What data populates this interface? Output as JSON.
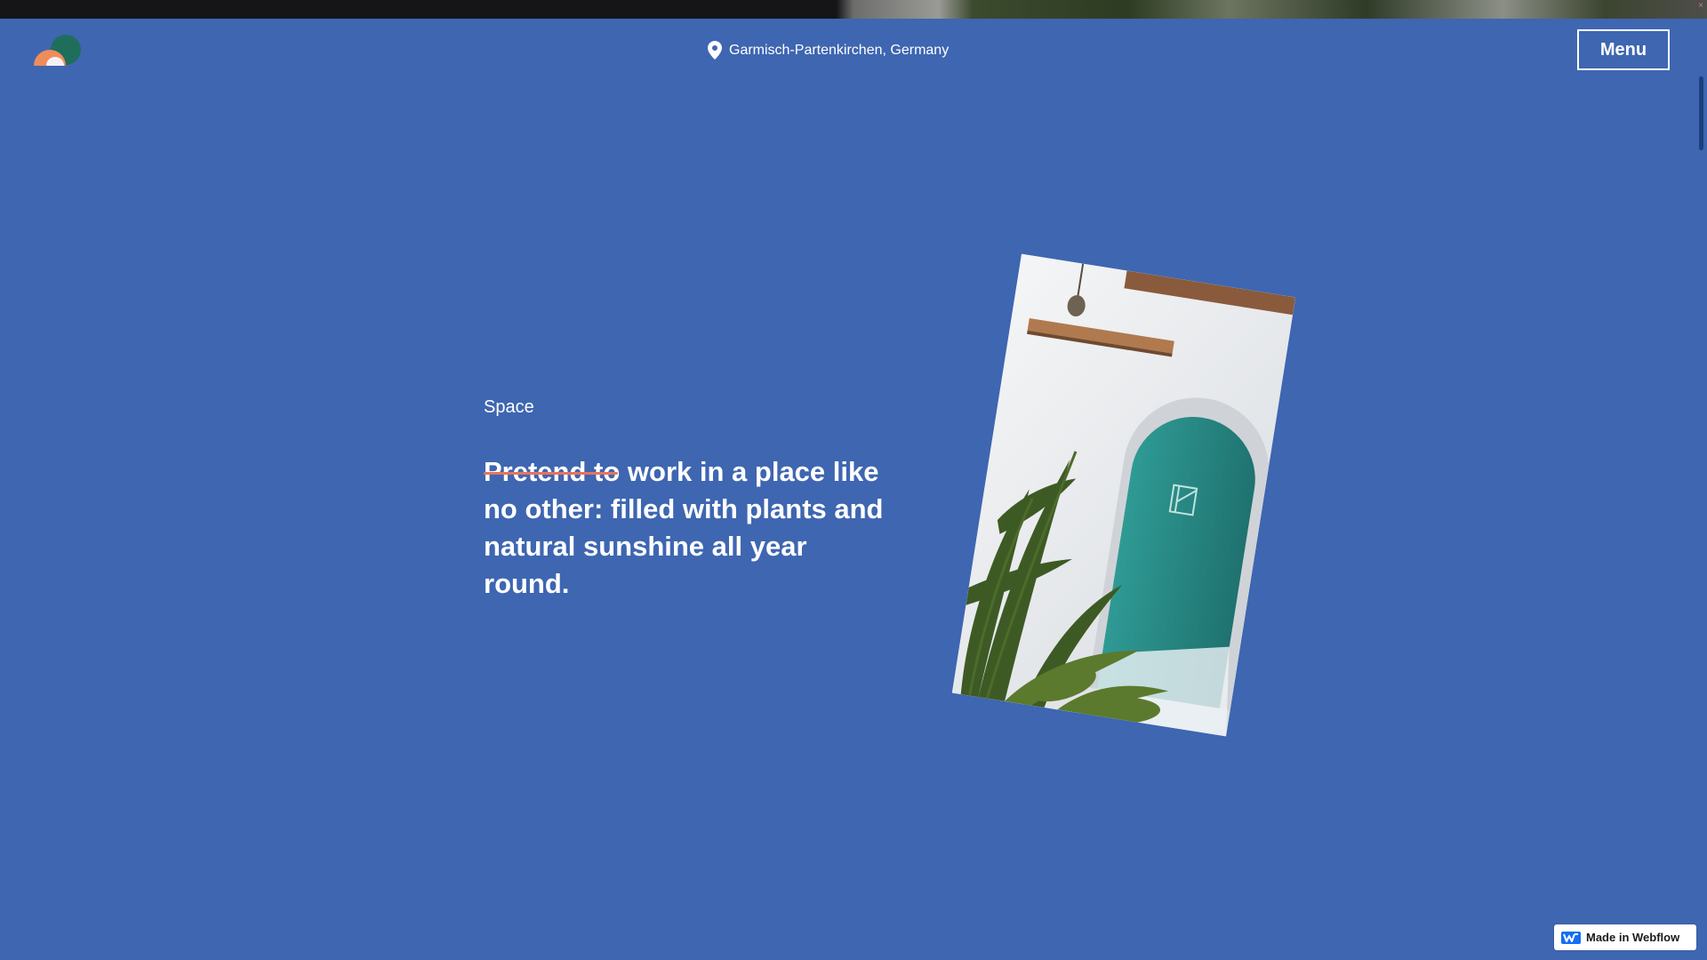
{
  "header": {
    "location": "Garmisch-Partenkirchen, Germany",
    "menu_label": "Menu"
  },
  "section": {
    "label": "Space",
    "headline_struck": "Pretend to",
    "headline_rest": " work in a place like no other: filled with plants and natural sunshine all year round."
  },
  "badge": {
    "label": "Made in Webflow"
  },
  "colors": {
    "background": "#3e66b1",
    "strike_accent": "#e8735b",
    "logo_green": "#1f6e5c",
    "logo_orange": "#f08c5c",
    "logo_white": "#f2f2f2",
    "door_teal": "#2b8a86"
  },
  "icons": {
    "location": "map-pin-icon",
    "logo": "brand-logo",
    "webflow": "webflow-logo-icon"
  }
}
